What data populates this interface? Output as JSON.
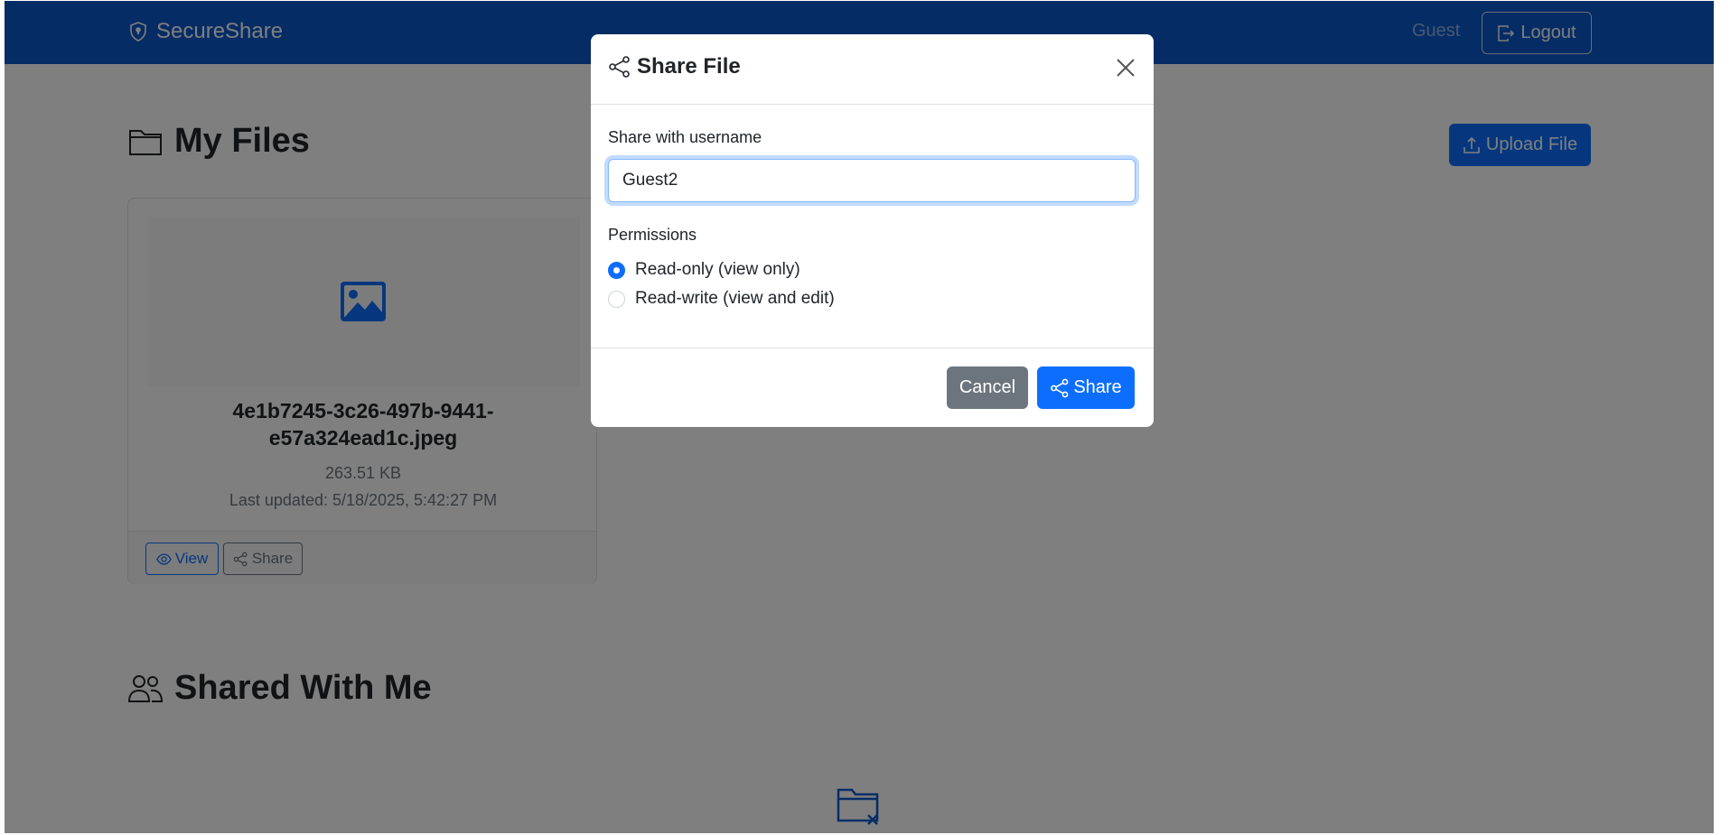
{
  "navbar": {
    "brand": "SecureShare",
    "user": "Guest",
    "logout_label": "Logout"
  },
  "my_files": {
    "title": "My Files",
    "upload_label": "Upload File",
    "files": [
      {
        "name": "4e1b7245-3c26-497b-9441-e57a324ead1c.jpeg",
        "size": "263.51 KB",
        "updated": "Last updated: 5/18/2025, 5:42:27 PM",
        "view_label": "View",
        "share_label": "Share"
      }
    ]
  },
  "shared": {
    "title": "Shared With Me"
  },
  "modal": {
    "title": "Share File",
    "username_label": "Share with username",
    "username_value": "Guest2",
    "permissions_label": "Permissions",
    "options": [
      {
        "label": "Read-only (view only)",
        "checked": true
      },
      {
        "label": "Read-write (view and edit)",
        "checked": false
      }
    ],
    "cancel_label": "Cancel",
    "share_label": "Share"
  },
  "colors": {
    "primary": "#0d6efd",
    "secondary": "#6c757d",
    "navbar": "#0a58ca"
  }
}
